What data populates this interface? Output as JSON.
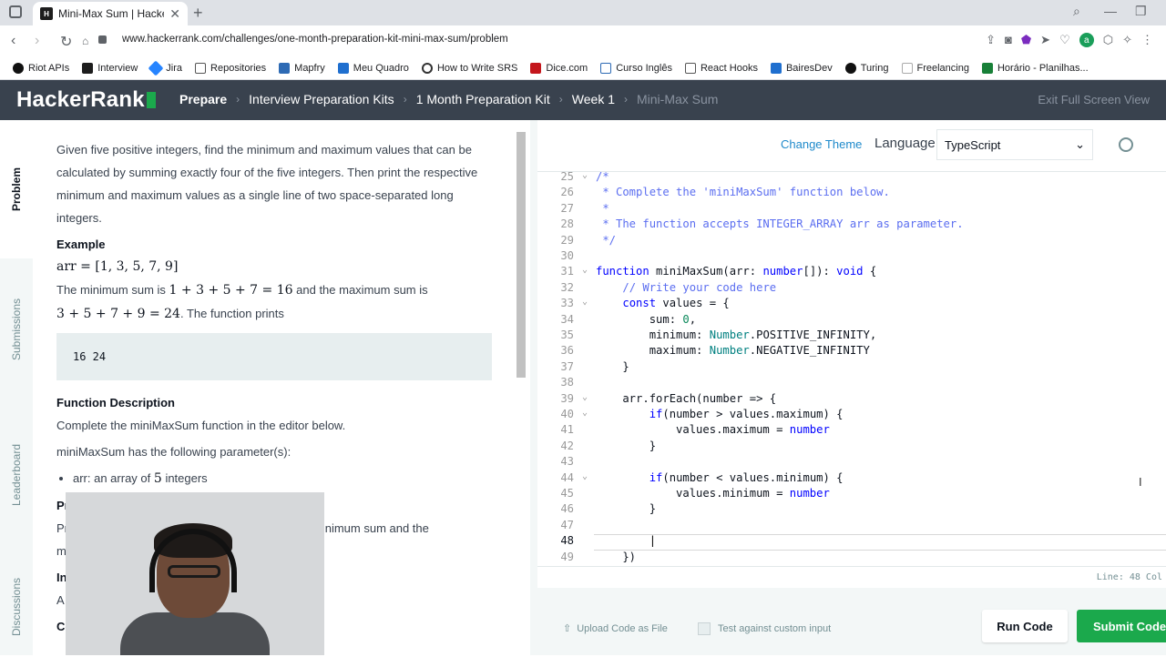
{
  "browser": {
    "tab_title": "Mini-Max Sum | HackerRank",
    "url": "www.hackerrank.com/challenges/one-month-preparation-kit-mini-max-sum/problem",
    "bookmarks": [
      "Riot APIs",
      "Interview",
      "Jira",
      "Repositories",
      "Mapfry",
      "Meu Quadro",
      "How to Write SRS",
      "Dice.com",
      "Curso Inglês",
      "React Hooks",
      "BairesDev",
      "Turing",
      "Freelancing",
      "Horário - Planilhas..."
    ]
  },
  "header": {
    "logo": "HackerRank",
    "crumbs": [
      "Prepare",
      "Interview Preparation Kits",
      "1 Month Preparation Kit",
      "Week 1",
      "Mini-Max Sum"
    ],
    "exit_fullscreen": "Exit Full Screen View"
  },
  "side_tabs": [
    "Problem",
    "Submissions",
    "Leaderboard",
    "Discussions"
  ],
  "problem": {
    "intro": "Given five positive integers, find the minimum and maximum values that can be calculated by summing exactly four of the five integers. Then print the respective minimum and maximum values as a single line of two space-separated long integers.",
    "example_heading": "Example",
    "example_math": "arr = [1, 3, 5, 7, 9]",
    "example_text_1": "The minimum sum is",
    "example_min_math": "1 + 3 + 5 + 7 = 16",
    "example_text_2": "and the maximum sum is",
    "example_max_math": "3 + 5 + 7 + 9 = 24",
    "example_text_3": ". The function prints",
    "sample_output": "16 24",
    "func_heading": "Function Description",
    "func_desc": "Complete the miniMaxSum function in the editor below.",
    "params_intro": "miniMaxSum has the following parameter(s):",
    "param_1_prefix": "arr: an array of",
    "param_1_num": "5",
    "param_1_suffix": "integers",
    "print_heading_partial": "Pri",
    "print_text_partial_1": "Pr",
    "print_text_partial_2": "minimum sum and the",
    "print_text_partial_3": "m",
    "input_heading_partial": "In",
    "input_text_partial": "A",
    "constraints_partial": "Co"
  },
  "editor": {
    "change_theme": "Change Theme",
    "language_label": "Language",
    "language_value": "TypeScript",
    "status_line": "Line: 48 Col",
    "lines": [
      {
        "n": "25",
        "fold": true,
        "html": "<span class='cm'>/*</span>"
      },
      {
        "n": "26",
        "fold": false,
        "html": "<span class='cm'> * Complete the 'miniMaxSum' function below.</span>"
      },
      {
        "n": "27",
        "fold": false,
        "html": "<span class='cm'> *</span>"
      },
      {
        "n": "28",
        "fold": false,
        "html": "<span class='cm'> * The function accepts INTEGER_ARRAY arr as parameter.</span>"
      },
      {
        "n": "29",
        "fold": false,
        "html": "<span class='cm'> */</span>"
      },
      {
        "n": "30",
        "fold": false,
        "html": ""
      },
      {
        "n": "31",
        "fold": true,
        "html": "<span class='kw'>function</span> miniMaxSum(arr: <span class='kw'>number</span>[]): <span class='kw'>void</span> {"
      },
      {
        "n": "32",
        "fold": false,
        "html": "    <span class='cm'>// Write your code here</span>"
      },
      {
        "n": "33",
        "fold": true,
        "html": "    <span class='kw'>const</span> values = {"
      },
      {
        "n": "34",
        "fold": false,
        "html": "        sum: <span class='nm'>0</span>,"
      },
      {
        "n": "35",
        "fold": false,
        "html": "        minimum: <span class='ty'>Number</span>.POSITIVE_INFINITY,"
      },
      {
        "n": "36",
        "fold": false,
        "html": "        maximum: <span class='ty'>Number</span>.NEGATIVE_INFINITY"
      },
      {
        "n": "37",
        "fold": false,
        "html": "    }"
      },
      {
        "n": "38",
        "fold": false,
        "html": ""
      },
      {
        "n": "39",
        "fold": true,
        "html": "    arr.forEach(number => {"
      },
      {
        "n": "40",
        "fold": true,
        "html": "        <span class='kw'>if</span>(number > values.maximum) {"
      },
      {
        "n": "41",
        "fold": false,
        "html": "            values.maximum = <span class='kw'>number</span>"
      },
      {
        "n": "42",
        "fold": false,
        "html": "        }"
      },
      {
        "n": "43",
        "fold": false,
        "html": ""
      },
      {
        "n": "44",
        "fold": true,
        "html": "        <span class='kw'>if</span>(number < values.minimum) {"
      },
      {
        "n": "45",
        "fold": false,
        "html": "            values.minimum = <span class='kw'>number</span>"
      },
      {
        "n": "46",
        "fold": false,
        "html": "        }"
      },
      {
        "n": "47",
        "fold": false,
        "html": ""
      },
      {
        "n": "48",
        "fold": false,
        "html": "        "
      },
      {
        "n": "49",
        "fold": false,
        "html": "    })"
      }
    ],
    "current_line": "48"
  },
  "actions": {
    "upload": "Upload Code as File",
    "custom_input": "Test against custom input",
    "run": "Run Code",
    "submit": "Submit Code"
  },
  "colors": {
    "header_bg": "#39424e",
    "accent_green": "#1ba94c",
    "link_blue": "#1f8acb"
  }
}
